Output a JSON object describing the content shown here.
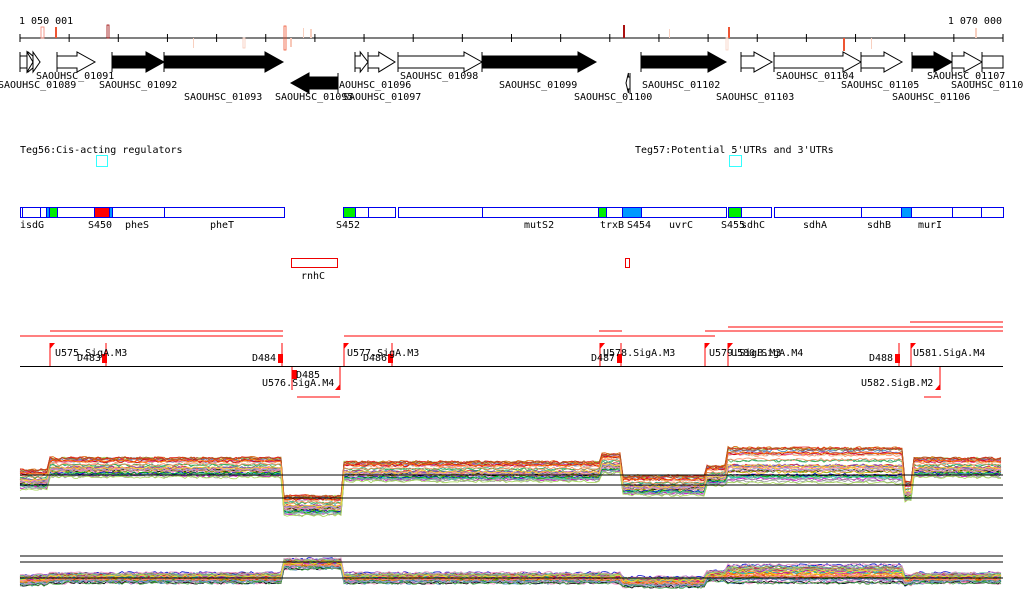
{
  "ruler": {
    "start_label": "1 050 001",
    "end_label": "1 070 000"
  },
  "genes": [
    {
      "label": "SAOUHSC_01089",
      "strand": "+",
      "fill": "white"
    },
    {
      "label": "SAOUHSC_01091",
      "strand": "+",
      "fill": "white"
    },
    {
      "label": "SAOUHSC_01092",
      "strand": "+",
      "fill": "black"
    },
    {
      "label": "SAOUHSC_01093",
      "strand": "+",
      "fill": "black"
    },
    {
      "label": "SAOUHSC_01095",
      "strand": "-",
      "fill": "black"
    },
    {
      "label": "SAOUHSC_01096",
      "strand": "+",
      "fill": "white"
    },
    {
      "label": "SAOUHSC_01097",
      "strand": "+",
      "fill": "white"
    },
    {
      "label": "SAOUHSC_01098",
      "strand": "+",
      "fill": "white"
    },
    {
      "label": "SAOUHSC_01099",
      "strand": "+",
      "fill": "black"
    },
    {
      "label": "SAOUHSC_01100",
      "strand": "-",
      "fill": "white"
    },
    {
      "label": "SAOUHSC_01102",
      "strand": "+",
      "fill": "black"
    },
    {
      "label": "SAOUHSC_01103",
      "strand": "+",
      "fill": "white"
    },
    {
      "label": "SAOUHSC_01104",
      "strand": "+",
      "fill": "white"
    },
    {
      "label": "SAOUHSC_01105",
      "strand": "+",
      "fill": "white"
    },
    {
      "label": "SAOUHSC_01106",
      "strand": "+",
      "fill": "black"
    },
    {
      "label": "SAOUHSC_01107",
      "strand": "+",
      "fill": "white"
    },
    {
      "label": "SAOUHSC_0110",
      "strand": "+",
      "fill": "white"
    }
  ],
  "tracks": {
    "teg56": "Teg56:Cis-acting regulators",
    "teg57": "Teg57:Potential 5'UTRs and 3'UTRs"
  },
  "operon_labels": [
    "isdG",
    "S450",
    "pheS",
    "pheT",
    "S452",
    "mutS2",
    "trxB",
    "S454",
    "uvrC",
    "S455",
    "sdhC",
    "sdhA",
    "sdhB",
    "murI"
  ],
  "extra_labels": [
    "rnhC"
  ],
  "features": [
    "U575.SigA.M3",
    "D483",
    "D484",
    "D485",
    "U576.SigA.M4",
    "U577.SigA.M3",
    "D486",
    "D487",
    "U578.SigA.M3",
    "U579.SigB.M3",
    "U580.SigA.M4",
    "D488",
    "U581.SigA.M4",
    "U582.SigB.M2"
  ],
  "colors": {
    "operon_border": "#0000ee",
    "sigma_green": "#00ee00",
    "srna_red": "#ff0000",
    "utr_blue": "#0099ff",
    "teg_cyan": "#33ffff",
    "feature_red": "#ff0000"
  }
}
